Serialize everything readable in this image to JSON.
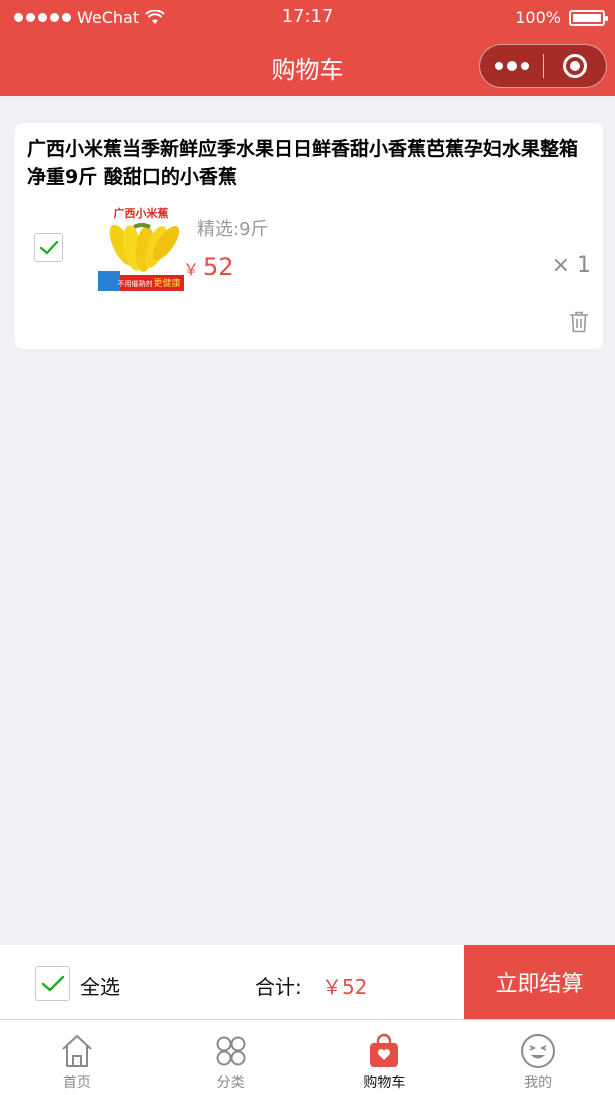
{
  "status_bar": {
    "carrier": "WeChat",
    "time": "17:17",
    "battery": "100%"
  },
  "nav": {
    "title": "购物车"
  },
  "cart": {
    "items": [
      {
        "title": "广西小米蕉当季新鲜应季水果日日鲜香甜小香蕉芭蕉孕妇水果整箱 净重9斤 酸甜口的小香蕉",
        "spec": "精选:9斤",
        "price_symbol": "￥",
        "price": "52",
        "quantity": "× 1",
        "checked": true,
        "thumb_banner": "广西小米蕉",
        "thumb_sticker_left": "不用催熟剂",
        "thumb_sticker_right": "更健康"
      }
    ]
  },
  "footer": {
    "select_all_label": "全选",
    "total_label": "合计:",
    "total_amount": "￥52",
    "checkout_label": "立即结算"
  },
  "tabbar": {
    "tabs": [
      {
        "label": "首页",
        "icon": "home-icon"
      },
      {
        "label": "分类",
        "icon": "category-icon"
      },
      {
        "label": "购物车",
        "icon": "cart-icon",
        "active": true
      },
      {
        "label": "我的",
        "icon": "profile-icon"
      }
    ]
  },
  "colors": {
    "accent": "#e54d45",
    "check_green": "#1aad19",
    "background": "#f0f1f5"
  }
}
